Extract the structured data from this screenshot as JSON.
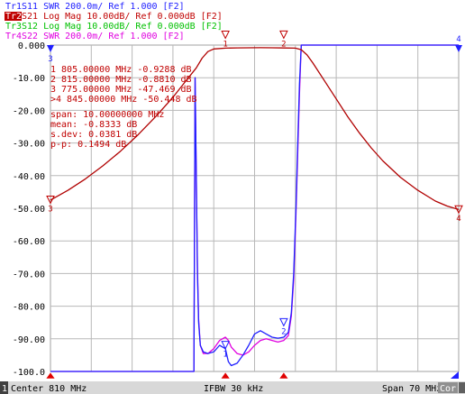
{
  "traces": [
    {
      "tag": "Tr1",
      "rest": " S11  SWR 200.0m/ Ref 1.000 [F2]",
      "color": "#2020ff",
      "active": false
    },
    {
      "tag": "Tr2",
      "rest": " S21  Log Mag 10.00dB/ Ref 0.000dB [F2]",
      "color": "#c00000",
      "active": true
    },
    {
      "tag": "Tr3",
      "rest": " S12  Log Mag 10.00dB/ Ref 0.000dB [F2]",
      "color": "#00c000",
      "active": false
    },
    {
      "tag": "Tr4",
      "rest": " S22  SWR 200.0m/ Ref 1.000 [F2]",
      "color": "#e000e0",
      "active": false
    }
  ],
  "colors": {
    "s11": "#2020ff",
    "s21": "#b00000",
    "s12": "#00a000",
    "s22": "#e000e0",
    "marker": "#e00000",
    "statusbar": "#d8d8d8"
  },
  "markers_table": [
    "  1   805.00000 MHz  -0.9288 dB",
    "  2   815.00000 MHz  -0.8810 dB",
    "  3   775.00000 MHz  -47.469 dB",
    " >4   845.00000 MHz  -50.448 dB"
  ],
  "stats": [
    "   span:  10.00000000 MHz",
    "   mean:  -0.8333 dB",
    " s.dev:  0.0381 dB",
    "   p-p:  0.1494 dB"
  ],
  "chart_data": {
    "type": "line",
    "xlim": [
      775,
      845
    ],
    "ylim": [
      -100,
      0
    ],
    "ytick_labels": [
      "0.000",
      "-10.00",
      "-20.00",
      "-30.00",
      "-40.00",
      "-50.00",
      "-60.00",
      "-70.00",
      "-80.00",
      "-90.00",
      "-100.0"
    ],
    "grid": true,
    "series": [
      {
        "name": "S21",
        "x": [
          775,
          778,
          781,
          784,
          787,
          790,
          793,
          796,
          798,
          800,
          801,
          802,
          803,
          805,
          807,
          809,
          811,
          813,
          815,
          817,
          818,
          819,
          820,
          822,
          824,
          826,
          828,
          830,
          832,
          835,
          838,
          841,
          843,
          845
        ],
        "y": [
          -47.5,
          -44.5,
          -41,
          -37,
          -32.5,
          -27.5,
          -22,
          -16,
          -11.5,
          -7,
          -4,
          -2,
          -1.2,
          -0.93,
          -0.86,
          -0.82,
          -0.8,
          -0.83,
          -0.88,
          -0.95,
          -1.4,
          -3,
          -5.5,
          -11,
          -16.5,
          -22,
          -27,
          -31.5,
          -35.5,
          -40.5,
          -44.5,
          -47.8,
          -49.3,
          -50.4
        ]
      },
      {
        "name": "S11",
        "x": [
          775,
          799.6,
          799.8,
          800,
          800.2,
          800.4,
          800.7,
          801.2,
          802,
          803,
          804,
          805,
          805.5,
          806,
          807,
          808,
          809,
          810,
          811,
          812,
          813,
          814,
          815,
          815.8,
          816.3,
          816.7,
          817.1,
          817.4,
          817.7,
          818,
          845
        ],
        "y": [
          -100,
          -100,
          -10,
          -40,
          -70,
          -85,
          -92,
          -94,
          -94.5,
          -94,
          -92,
          -93,
          -97,
          -98.2,
          -97.5,
          -95,
          -92,
          -88.5,
          -87.5,
          -88.5,
          -89.5,
          -89.8,
          -89.5,
          -88,
          -82,
          -70,
          -50,
          -30,
          -12,
          0,
          0
        ]
      },
      {
        "name": "S22",
        "x": [
          775,
          799.6,
          799.8,
          800,
          800.2,
          800.4,
          800.7,
          801.2,
          802,
          803,
          804,
          805,
          805.5,
          806,
          807,
          808,
          809,
          810,
          811,
          812,
          813,
          814,
          815,
          815.8,
          816.3,
          816.7,
          817.1,
          817.4,
          817.7,
          818,
          845
        ],
        "y": [
          -100,
          -100,
          -10,
          -40,
          -68,
          -84,
          -92,
          -94.5,
          -94.5,
          -93,
          -90.5,
          -89.5,
          -90.5,
          -92.5,
          -94.5,
          -95,
          -94,
          -92,
          -90.5,
          -90,
          -90.5,
          -91,
          -90.5,
          -89,
          -83,
          -72,
          -52,
          -33,
          -15,
          0,
          0
        ]
      }
    ],
    "markers": [
      {
        "label": "1",
        "x": 805,
        "y": -0.93
      },
      {
        "label": "2",
        "x": 815,
        "y": -0.88
      },
      {
        "label": "3",
        "x": 775,
        "y": -47.47
      },
      {
        "label": "4",
        "x": 845,
        "y": -50.45
      }
    ],
    "s11_markers": [
      {
        "label": "1",
        "x": 805,
        "y": -97
      },
      {
        "label": "2",
        "x": 815,
        "y": -90
      }
    ],
    "s22_markers": [
      {
        "label": "1",
        "x": 805,
        "y": -89.5
      },
      {
        "label": "2",
        "x": 815,
        "y": -90.5
      }
    ],
    "left_edge_marks": [
      "4",
      "3"
    ],
    "right_edge_marks": [
      "4",
      "3"
    ]
  },
  "statusbar": {
    "channel": "1",
    "center": "Center 810 MHz",
    "ifbw": "IFBW 30 kHz",
    "span": "Span 70 MHz",
    "cor": "Cor"
  }
}
